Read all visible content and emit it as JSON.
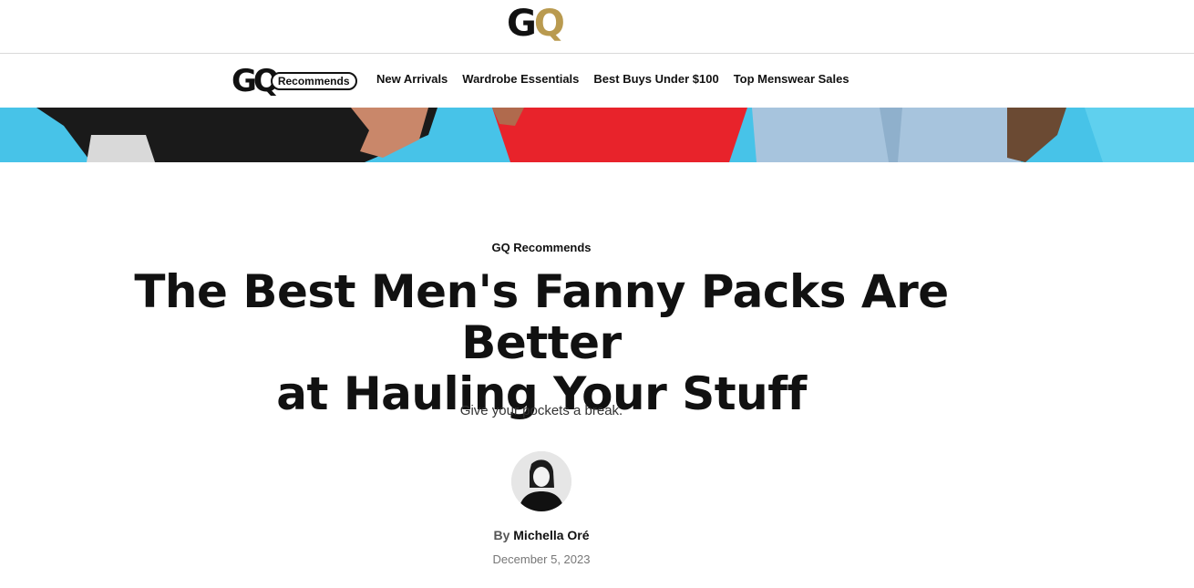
{
  "header": {
    "logo_g": "G",
    "logo_q": "Q",
    "brand_color": "#b99a4f"
  },
  "nav": {
    "logo_mark": "GQ",
    "logo_label": "Recommends",
    "links": [
      {
        "label": "New Arrivals"
      },
      {
        "label": "Wardrobe Essentials"
      },
      {
        "label": "Best Buys Under $100"
      },
      {
        "label": "Top Menswear Sales"
      }
    ]
  },
  "hero": {
    "background_color": "#47c3e8"
  },
  "article": {
    "kicker": "GQ Recommends",
    "headline_line1": "The Best Men's Fanny Packs Are Better",
    "headline_line2": "at Hauling Your Stuff",
    "dek": "Give your pockets a break.",
    "byline_prefix": "By",
    "author": "Michella Oré",
    "date": "December 5, 2023"
  }
}
